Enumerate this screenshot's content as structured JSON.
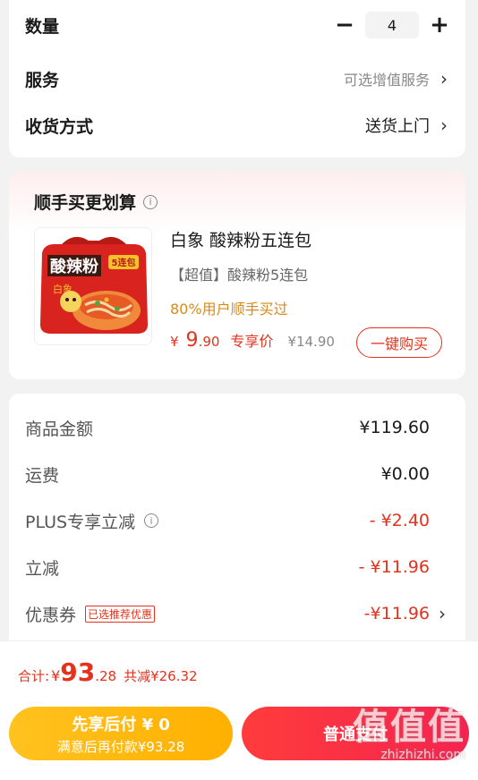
{
  "top": {
    "quantity_label": "数量",
    "qty_minus": "−",
    "qty_value": "4",
    "qty_plus": "+",
    "service_label": "服务",
    "service_value": "可选增值服务",
    "delivery_label": "收货方式",
    "delivery_value": "送货上门",
    "chevron": "›"
  },
  "bundle": {
    "title": "顺手买更划算",
    "info_glyph": "i",
    "product_name": "白象 酸辣粉五连包",
    "product_sub": "【超值】酸辣粉5连包",
    "product_stat": "80%用户顺手买过",
    "price_symbol": "¥",
    "price_int": "9",
    "price_dec": ".90",
    "price_tag": "专享价",
    "orig_price": "¥14.90",
    "buy_button": "一键购买",
    "image_text": "酸辣粉",
    "image_badge": "5连包",
    "image_brand": "白象"
  },
  "summary": {
    "rows": [
      {
        "label": "商品金额",
        "value": "¥119.60"
      },
      {
        "label": "运费",
        "value": "¥0.00"
      },
      {
        "label": "PLUS专享立减",
        "value": "- ¥2.40"
      },
      {
        "label": "立减",
        "value": "- ¥11.96"
      },
      {
        "label": "优惠券",
        "badge": "已选推荐优惠",
        "value": "-¥11.96"
      }
    ]
  },
  "total": {
    "label": "合计:",
    "symbol": "¥",
    "int": "93",
    "dec": ".28",
    "saved": "共减¥26.32"
  },
  "actions": {
    "later_title": "先享后付 ¥ 0",
    "later_sub": "满意后再付款¥93.28",
    "pay_label": "普通支付"
  },
  "watermark": {
    "glyphs": "值值值",
    "text": "zhizhizhi.com"
  },
  "colors": {
    "accent_red": "#e4321d",
    "gold": "#ffb000",
    "stat_orange": "#d98a1c"
  }
}
